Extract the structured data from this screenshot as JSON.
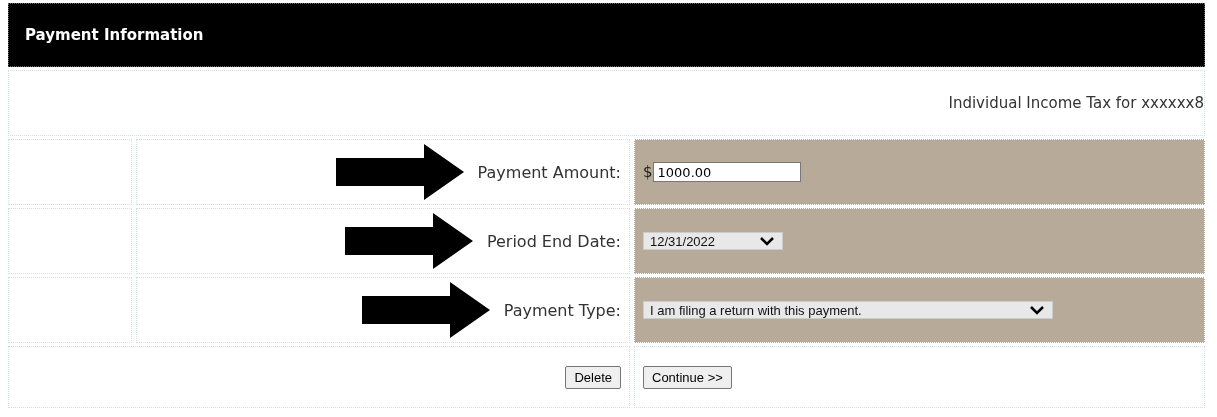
{
  "header": {
    "title": "Payment Information"
  },
  "subtitle": "Individual Income Tax for xxxxxx8",
  "fields": [
    {
      "kind": "text",
      "label": "Payment Amount:",
      "prefix": "$",
      "value": "1000.00",
      "arrow": true
    },
    {
      "kind": "select",
      "label": "Period End Date:",
      "value": "12/31/2022",
      "arrow": true
    },
    {
      "kind": "select",
      "label": "Payment Type:",
      "value": "I am filing a return with this payment.",
      "arrow": true
    }
  ],
  "buttons": [
    {
      "label": "Delete"
    },
    {
      "label": "Continue >>"
    }
  ]
}
